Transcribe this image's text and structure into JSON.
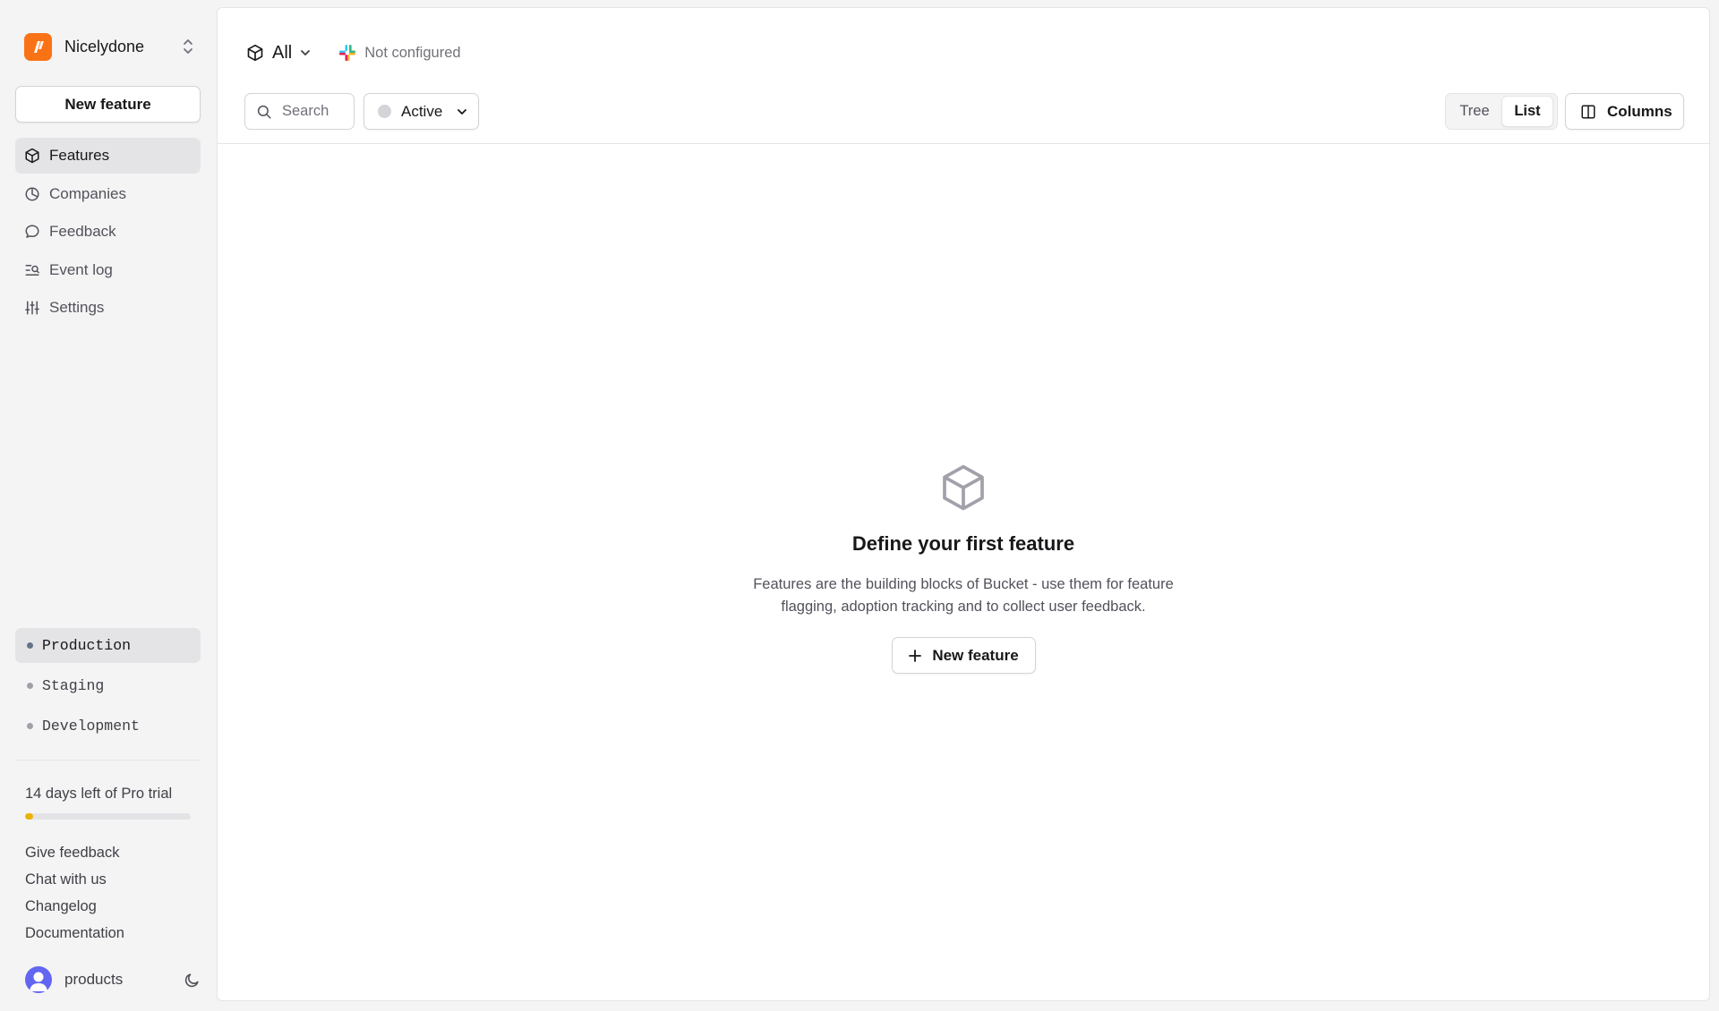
{
  "org": {
    "name": "Nicelydone",
    "logo_icon": "org-logo-icon",
    "brand_color": "#f97316"
  },
  "sidebar": {
    "new_feature_label": "New feature",
    "nav": [
      {
        "label": "Features",
        "icon": "cube-icon",
        "active": true
      },
      {
        "label": "Companies",
        "icon": "pie-chart-icon",
        "active": false
      },
      {
        "label": "Feedback",
        "icon": "message-bubble-icon",
        "active": false
      },
      {
        "label": "Event log",
        "icon": "event-log-icon",
        "active": false
      },
      {
        "label": "Settings",
        "icon": "sliders-icon",
        "active": false
      }
    ],
    "environments": [
      {
        "label": "Production",
        "active": true
      },
      {
        "label": "Staging",
        "active": false
      },
      {
        "label": "Development",
        "active": false
      }
    ],
    "trial": {
      "text": "14 days left of Pro trial",
      "progress_fraction": 0.05,
      "bar_color": "#eab308"
    },
    "links": [
      "Give feedback",
      "Chat with us",
      "Changelog",
      "Documentation"
    ],
    "user": {
      "name": "products",
      "avatar_color": "#6366f1"
    }
  },
  "header": {
    "scope_label": "All",
    "slack_status": "Not configured"
  },
  "toolbar": {
    "search_placeholder": "Search",
    "status_filter": "Active",
    "view_tree": "Tree",
    "view_list": "List",
    "selected_view": "List",
    "columns_label": "Columns"
  },
  "empty_state": {
    "title": "Define your first feature",
    "description": "Features are the building blocks of Bucket - use them for feature flagging, adoption tracking and to collect user feedback.",
    "button_label": "New feature"
  }
}
